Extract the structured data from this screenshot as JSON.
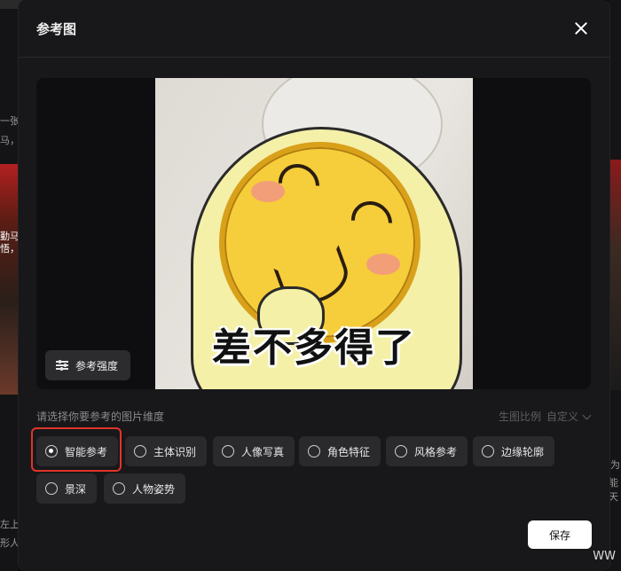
{
  "background": {
    "left_text": [
      "一张",
      "马，",
      "勤马",
      "悟，",
      "左上",
      "形人"
    ],
    "right_text": [
      "为",
      "能天"
    ]
  },
  "modal": {
    "title": "参考图",
    "close_icon": "close-icon"
  },
  "preview": {
    "meme_caption": "差不多得了",
    "strength_button": {
      "label": "参考强度",
      "icon": "sliders-icon"
    }
  },
  "dimension": {
    "hint": "请选择你要参考的图片维度",
    "ratio_label": "生图比例",
    "ratio_value": "自定义",
    "options": [
      {
        "label": "智能参考",
        "selected": true
      },
      {
        "label": "主体识别",
        "selected": false
      },
      {
        "label": "人像写真",
        "selected": false
      },
      {
        "label": "角色特征",
        "selected": false
      },
      {
        "label": "风格参考",
        "selected": false
      },
      {
        "label": "边缘轮廓",
        "selected": false
      },
      {
        "label": "景深",
        "selected": false
      },
      {
        "label": "人物姿势",
        "selected": false
      }
    ]
  },
  "footer": {
    "save_label": "保存"
  },
  "watermark": "WW",
  "colors": {
    "highlight": "#e0342a",
    "panel": "#18181a",
    "chip": "#2a2a2d"
  }
}
